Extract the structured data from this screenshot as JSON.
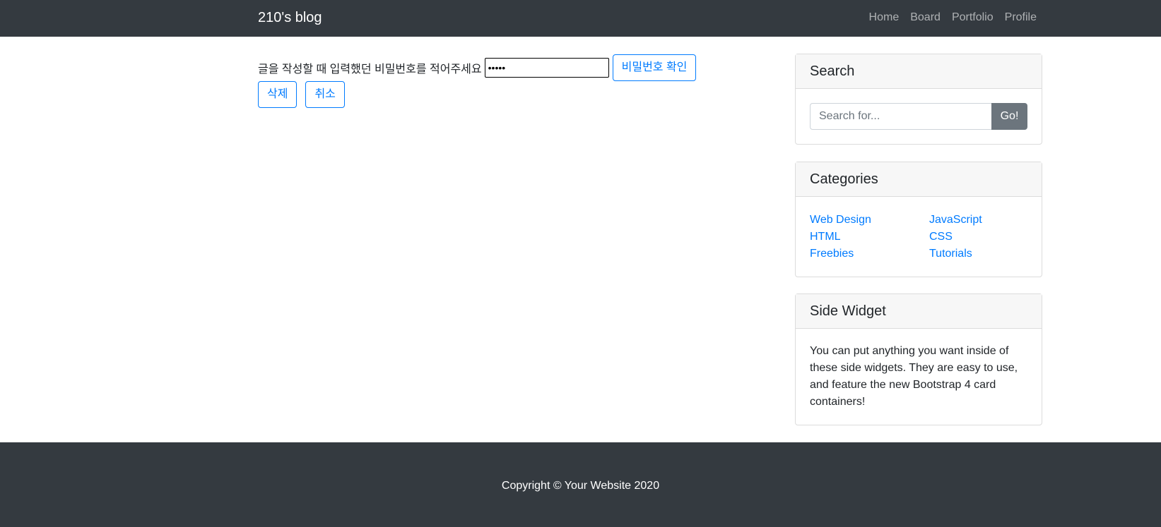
{
  "navbar": {
    "brand": "210's blog",
    "links": [
      "Home",
      "Board",
      "Portfolio",
      "Profile"
    ]
  },
  "main": {
    "prompt": "글을 작성할 때 입력했던 비밀번호를 적어주세요",
    "password_value": "12345",
    "confirm_button": "비밀번호 확인",
    "delete_button": "삭제",
    "cancel_button": "취소"
  },
  "sidebar": {
    "search": {
      "title": "Search",
      "placeholder": "Search for...",
      "button": "Go!"
    },
    "categories": {
      "title": "Categories",
      "left": [
        "Web Design",
        "HTML",
        "Freebies"
      ],
      "right": [
        "JavaScript",
        "CSS",
        "Tutorials"
      ]
    },
    "widget": {
      "title": "Side Widget",
      "text": "You can put anything you want inside of these side widgets. They are easy to use, and feature the new Bootstrap 4 card containers!"
    }
  },
  "footer": {
    "copyright": "Copyright © Your Website 2020"
  },
  "colors": {
    "navbar_bg": "#343a40",
    "link": "#007bff",
    "secondary": "#6c757d"
  }
}
